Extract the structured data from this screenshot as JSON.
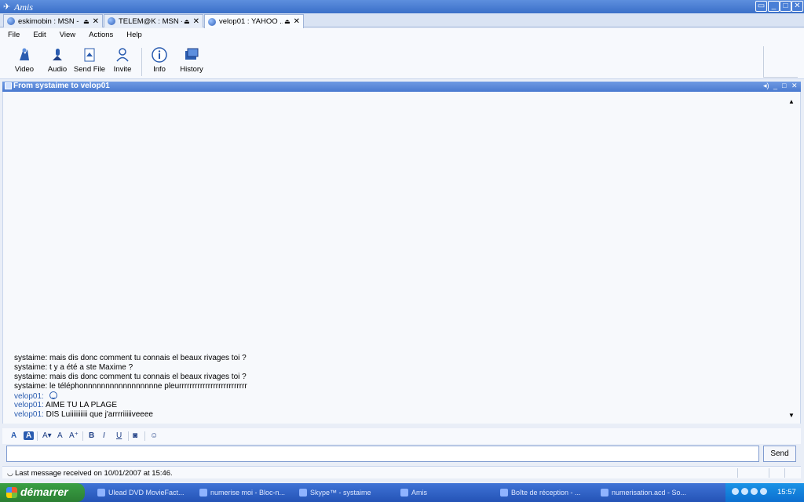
{
  "window": {
    "title": "Amis"
  },
  "tabs": [
    {
      "label": "eskimobin : MSN - ...",
      "active": false
    },
    {
      "label": "TELEM@K : MSN - ...",
      "active": false
    },
    {
      "label": "velop01 : YAHOO ...",
      "active": true
    }
  ],
  "menu": [
    "File",
    "Edit",
    "View",
    "Actions",
    "Help"
  ],
  "toolbar": {
    "video": "Video",
    "audio": "Audio",
    "send_file": "Send File",
    "invite": "Invite",
    "info": "Info",
    "history": "History"
  },
  "conversation": {
    "title": "From systaime to velop01",
    "messages": [
      {
        "sender": "systaime:",
        "text": "mais dis donc comment tu connais el beaux rivages toi ?",
        "remote": false
      },
      {
        "sender": "systaime:",
        "text": "t y a été a ste Maxime ?",
        "remote": false
      },
      {
        "sender": "systaime:",
        "text": "mais dis donc comment tu connais el beaux rivages toi ?",
        "remote": false
      },
      {
        "sender": "systaime:",
        "text": "le téléphonnnnnnnnnnnnnnnnne pleurrrrrrrrrrrrrrrrrrrrrrrrrr",
        "remote": false
      },
      {
        "sender": "velop01:",
        "text": "",
        "remote": true,
        "smiley": true
      },
      {
        "sender": "velop01:",
        "text": "AIME TU LA PLAGE",
        "remote": true
      },
      {
        "sender": "velop01:",
        "text": "DIS Luiiiiiiiiii que j'arrrriiiiiveeee",
        "remote": true
      }
    ]
  },
  "format": {
    "font_color": "A",
    "bg_color": "A",
    "font_size": "A▾",
    "shrink": "A",
    "grow": "A⁺",
    "bold": "B",
    "italic": "I",
    "underline": "U"
  },
  "input": {
    "value": "",
    "send_label": "Send"
  },
  "status": {
    "text": "Last message received on 10/01/2007 at 15:46."
  },
  "taskbar": {
    "start_label": "démarrer",
    "tasks": [
      "Ulead DVD MovieFact...",
      "numerise moi - Bloc-n...",
      "Skype™ - systaime",
      "Amis",
      "Boîte de réception - ...",
      "numerisation.acd - So..."
    ],
    "clock": "15:57"
  },
  "colors": {
    "accent": "#3a6fc8",
    "taskbar": "#2453b6",
    "remote_sender": "#2a5cb0"
  }
}
